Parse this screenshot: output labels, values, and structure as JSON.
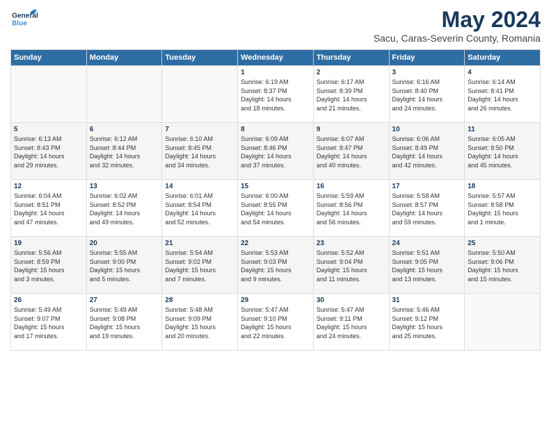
{
  "header": {
    "logo_general": "General",
    "logo_blue": "Blue",
    "title": "May 2024",
    "subtitle": "Sacu, Caras-Severin County, Romania"
  },
  "weekdays": [
    "Sunday",
    "Monday",
    "Tuesday",
    "Wednesday",
    "Thursday",
    "Friday",
    "Saturday"
  ],
  "weeks": [
    [
      {
        "day": "",
        "info": ""
      },
      {
        "day": "",
        "info": ""
      },
      {
        "day": "",
        "info": ""
      },
      {
        "day": "1",
        "info": "Sunrise: 6:19 AM\nSunset: 8:37 PM\nDaylight: 14 hours\nand 18 minutes."
      },
      {
        "day": "2",
        "info": "Sunrise: 6:17 AM\nSunset: 8:39 PM\nDaylight: 14 hours\nand 21 minutes."
      },
      {
        "day": "3",
        "info": "Sunrise: 6:16 AM\nSunset: 8:40 PM\nDaylight: 14 hours\nand 24 minutes."
      },
      {
        "day": "4",
        "info": "Sunrise: 6:14 AM\nSunset: 8:41 PM\nDaylight: 14 hours\nand 26 minutes."
      }
    ],
    [
      {
        "day": "5",
        "info": "Sunrise: 6:13 AM\nSunset: 8:43 PM\nDaylight: 14 hours\nand 29 minutes."
      },
      {
        "day": "6",
        "info": "Sunrise: 6:12 AM\nSunset: 8:44 PM\nDaylight: 14 hours\nand 32 minutes."
      },
      {
        "day": "7",
        "info": "Sunrise: 6:10 AM\nSunset: 8:45 PM\nDaylight: 14 hours\nand 34 minutes."
      },
      {
        "day": "8",
        "info": "Sunrise: 6:09 AM\nSunset: 8:46 PM\nDaylight: 14 hours\nand 37 minutes."
      },
      {
        "day": "9",
        "info": "Sunrise: 6:07 AM\nSunset: 8:47 PM\nDaylight: 14 hours\nand 40 minutes."
      },
      {
        "day": "10",
        "info": "Sunrise: 6:06 AM\nSunset: 8:49 PM\nDaylight: 14 hours\nand 42 minutes."
      },
      {
        "day": "11",
        "info": "Sunrise: 6:05 AM\nSunset: 8:50 PM\nDaylight: 14 hours\nand 45 minutes."
      }
    ],
    [
      {
        "day": "12",
        "info": "Sunrise: 6:04 AM\nSunset: 8:51 PM\nDaylight: 14 hours\nand 47 minutes."
      },
      {
        "day": "13",
        "info": "Sunrise: 6:02 AM\nSunset: 8:52 PM\nDaylight: 14 hours\nand 49 minutes."
      },
      {
        "day": "14",
        "info": "Sunrise: 6:01 AM\nSunset: 8:54 PM\nDaylight: 14 hours\nand 52 minutes."
      },
      {
        "day": "15",
        "info": "Sunrise: 6:00 AM\nSunset: 8:55 PM\nDaylight: 14 hours\nand 54 minutes."
      },
      {
        "day": "16",
        "info": "Sunrise: 5:59 AM\nSunset: 8:56 PM\nDaylight: 14 hours\nand 56 minutes."
      },
      {
        "day": "17",
        "info": "Sunrise: 5:58 AM\nSunset: 8:57 PM\nDaylight: 14 hours\nand 59 minutes."
      },
      {
        "day": "18",
        "info": "Sunrise: 5:57 AM\nSunset: 8:58 PM\nDaylight: 15 hours\nand 1 minute."
      }
    ],
    [
      {
        "day": "19",
        "info": "Sunrise: 5:56 AM\nSunset: 8:59 PM\nDaylight: 15 hours\nand 3 minutes."
      },
      {
        "day": "20",
        "info": "Sunrise: 5:55 AM\nSunset: 9:00 PM\nDaylight: 15 hours\nand 5 minutes."
      },
      {
        "day": "21",
        "info": "Sunrise: 5:54 AM\nSunset: 9:02 PM\nDaylight: 15 hours\nand 7 minutes."
      },
      {
        "day": "22",
        "info": "Sunrise: 5:53 AM\nSunset: 9:03 PM\nDaylight: 15 hours\nand 9 minutes."
      },
      {
        "day": "23",
        "info": "Sunrise: 5:52 AM\nSunset: 9:04 PM\nDaylight: 15 hours\nand 11 minutes."
      },
      {
        "day": "24",
        "info": "Sunrise: 5:51 AM\nSunset: 9:05 PM\nDaylight: 15 hours\nand 13 minutes."
      },
      {
        "day": "25",
        "info": "Sunrise: 5:50 AM\nSunset: 9:06 PM\nDaylight: 15 hours\nand 15 minutes."
      }
    ],
    [
      {
        "day": "26",
        "info": "Sunrise: 5:49 AM\nSunset: 9:07 PM\nDaylight: 15 hours\nand 17 minutes."
      },
      {
        "day": "27",
        "info": "Sunrise: 5:49 AM\nSunset: 9:08 PM\nDaylight: 15 hours\nand 19 minutes."
      },
      {
        "day": "28",
        "info": "Sunrise: 5:48 AM\nSunset: 9:09 PM\nDaylight: 15 hours\nand 20 minutes."
      },
      {
        "day": "29",
        "info": "Sunrise: 5:47 AM\nSunset: 9:10 PM\nDaylight: 15 hours\nand 22 minutes."
      },
      {
        "day": "30",
        "info": "Sunrise: 5:47 AM\nSunset: 9:11 PM\nDaylight: 15 hours\nand 24 minutes."
      },
      {
        "day": "31",
        "info": "Sunrise: 5:46 AM\nSunset: 9:12 PM\nDaylight: 15 hours\nand 25 minutes."
      },
      {
        "day": "",
        "info": ""
      }
    ]
  ]
}
